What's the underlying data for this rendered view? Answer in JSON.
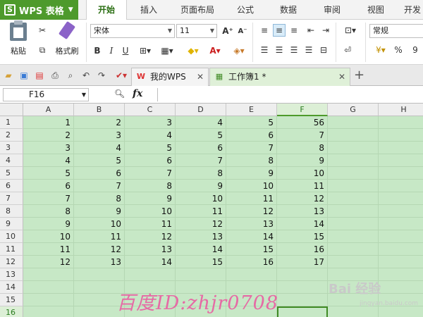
{
  "app": {
    "name": "WPS 表格",
    "logo_letter": "S"
  },
  "menu": [
    "开始",
    "插入",
    "页面布局",
    "公式",
    "数据",
    "审阅",
    "视图",
    "开发"
  ],
  "ribbon": {
    "paste": "粘贴",
    "format_painter": "格式刷",
    "font_name": "宋体",
    "font_size": "11",
    "number_format": "常规",
    "bold": "B",
    "italic": "I",
    "underline": "U",
    "percent": "%",
    "comma": "9"
  },
  "tabs": [
    {
      "label": "我的WPS"
    },
    {
      "label": "工作簿1 *"
    }
  ],
  "formula_bar": {
    "cell_ref": "F16",
    "fx": "fx",
    "value": ""
  },
  "columns": [
    "A",
    "B",
    "C",
    "D",
    "E",
    "F",
    "G",
    "H"
  ],
  "rows": [
    "1",
    "2",
    "3",
    "4",
    "5",
    "6",
    "7",
    "8",
    "9",
    "10",
    "11",
    "12",
    "13",
    "14",
    "15",
    "16"
  ],
  "cells": [
    [
      "1",
      "2",
      "3",
      "4",
      "5",
      "56"
    ],
    [
      "2",
      "3",
      "4",
      "5",
      "6",
      "7"
    ],
    [
      "3",
      "4",
      "5",
      "6",
      "7",
      "8"
    ],
    [
      "4",
      "5",
      "6",
      "7",
      "8",
      "9"
    ],
    [
      "5",
      "6",
      "7",
      "8",
      "9",
      "10"
    ],
    [
      "6",
      "7",
      "8",
      "9",
      "10",
      "11"
    ],
    [
      "7",
      "8",
      "9",
      "10",
      "11",
      "12"
    ],
    [
      "8",
      "9",
      "10",
      "11",
      "12",
      "13"
    ],
    [
      "9",
      "10",
      "11",
      "12",
      "13",
      "14"
    ],
    [
      "10",
      "11",
      "12",
      "13",
      "14",
      "15"
    ],
    [
      "11",
      "12",
      "13",
      "14",
      "15",
      "16"
    ],
    [
      "12",
      "13",
      "14",
      "15",
      "16",
      "17"
    ]
  ],
  "watermark": "百度ID:zhjr0708",
  "baidu_logo": "Bai 经验",
  "baidu_sub": "jingyan.baidu.com",
  "colors": {
    "accent": "#4e9a2c",
    "grid_bg": "#c7e8c6",
    "watermark": "#e66aa5"
  }
}
